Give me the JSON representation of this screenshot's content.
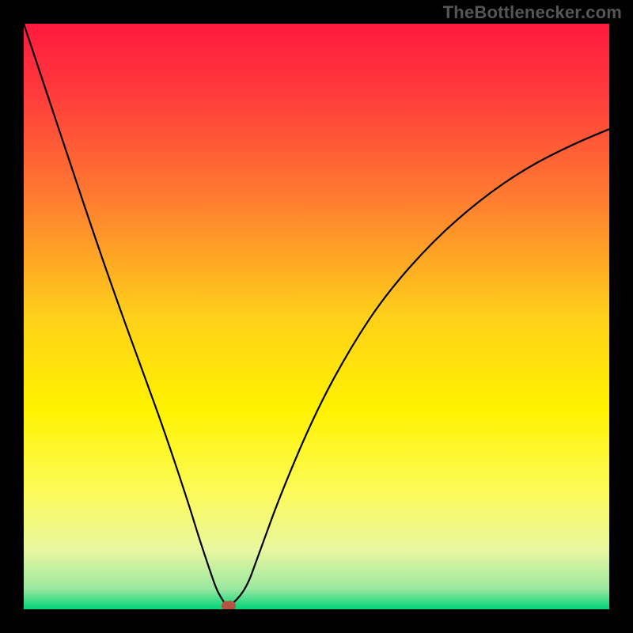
{
  "watermark": "TheBottlenecker.com",
  "chart_data": {
    "type": "line",
    "title": "",
    "xlabel": "",
    "ylabel": "",
    "xlim": [
      0,
      100
    ],
    "ylim": [
      0,
      100
    ],
    "grid": false,
    "background_gradient": {
      "stops": [
        {
          "pos": 0.0,
          "color": "#ff193e"
        },
        {
          "pos": 0.12,
          "color": "#ff3b3c"
        },
        {
          "pos": 0.3,
          "color": "#ff7d30"
        },
        {
          "pos": 0.5,
          "color": "#ffd01a"
        },
        {
          "pos": 0.66,
          "color": "#fff300"
        },
        {
          "pos": 0.8,
          "color": "#fcfb5a"
        },
        {
          "pos": 0.9,
          "color": "#e8f7a0"
        },
        {
          "pos": 0.965,
          "color": "#9ae8a0"
        },
        {
          "pos": 1.0,
          "color": "#00d477"
        }
      ]
    },
    "series": [
      {
        "name": "curve",
        "color": "#000000",
        "x": [
          0,
          4,
          8,
          12,
          16,
          20,
          24,
          28,
          30,
          32,
          33,
          34,
          34.6,
          35.4,
          38,
          40,
          44,
          50,
          56,
          62,
          70,
          78,
          86,
          94,
          100
        ],
        "y": [
          100,
          88,
          76,
          64,
          52.5,
          41.5,
          30.5,
          18.5,
          12,
          6,
          3.2,
          1.5,
          0.6,
          0.6,
          3.5,
          9,
          20,
          34,
          45,
          54,
          63,
          70,
          75.5,
          79.5,
          82
        ]
      }
    ],
    "markers": [
      {
        "name": "optimum-marker",
        "shape": "rounded-rect",
        "x": 35,
        "y": 0.6,
        "color": "#b15441"
      }
    ]
  },
  "layout": {
    "image_size": 800,
    "plot_margin": 30
  }
}
